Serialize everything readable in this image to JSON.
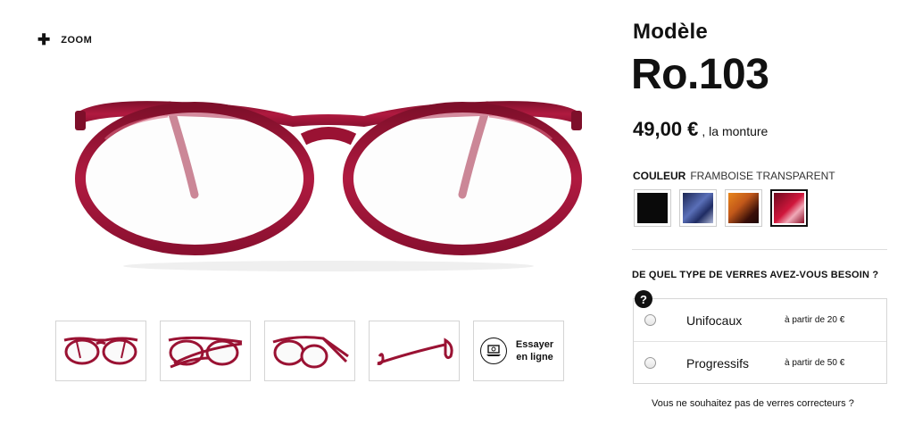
{
  "zoom": {
    "icon": "plus-icon",
    "label": "ZOOM"
  },
  "product": {
    "model_label": "Modèle",
    "model_name": "Ro.103",
    "price": "49,00 €",
    "price_suffix": ", la monture",
    "frame_color": "#9a1233"
  },
  "color": {
    "label": "COULEUR",
    "value": "FRAMBOISE TRANSPARENT",
    "swatches": [
      {
        "name": "black",
        "hex": "#0a0a0a",
        "selected": false
      },
      {
        "name": "blue",
        "hex": "#2d3f7a",
        "selected": false
      },
      {
        "name": "tortoise",
        "hex": "#c2581a",
        "selected": false
      },
      {
        "name": "framboise",
        "hex": "#b3102e",
        "selected": true
      }
    ]
  },
  "lenses": {
    "question": "DE QUEL TYPE DE VERRES AVEZ-VOUS BESOIN ?",
    "help_icon": "?",
    "options": [
      {
        "label": "Unifocaux",
        "price": "à partir de 20 €"
      },
      {
        "label": "Progressifs",
        "price": "à partir de 50 €"
      }
    ],
    "no_lens": "Vous ne souhaitez pas de verres correcteurs ?"
  },
  "thumbnails": {
    "views": [
      "front",
      "three-quarter",
      "angled",
      "side"
    ],
    "try_on": {
      "icon": "laptop-icon",
      "line1": "Essayer",
      "line2": "en ligne"
    }
  }
}
